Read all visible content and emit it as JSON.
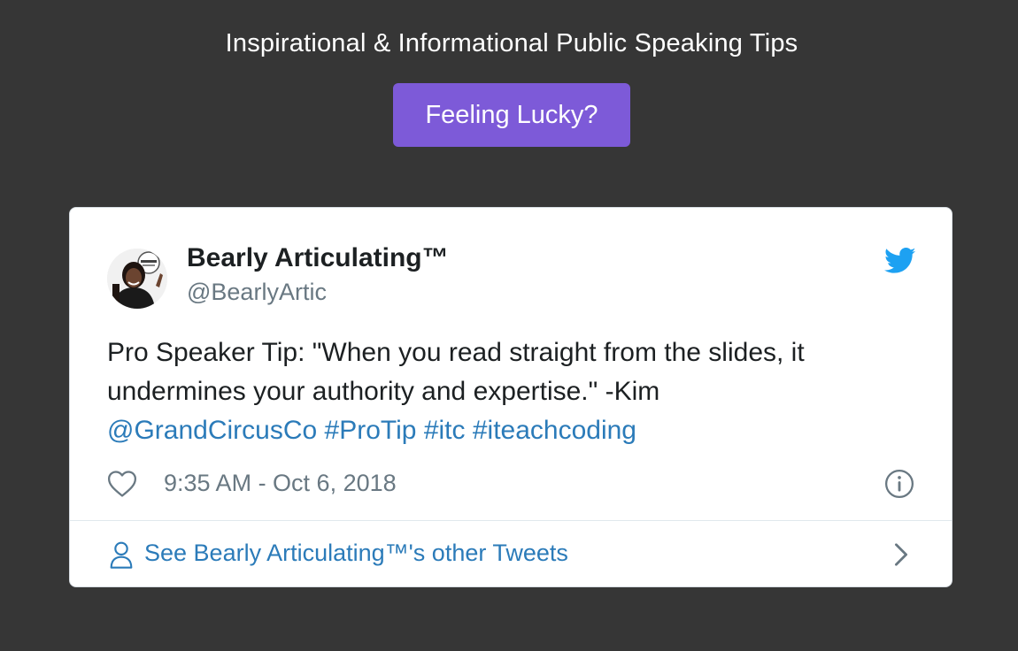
{
  "header": {
    "title": "Inspirational & Informational Public Speaking Tips",
    "button_label": "Feeling Lucky?"
  },
  "tweet": {
    "author_name": "Bearly Articulating™",
    "author_handle": "@BearlyArtic",
    "text_line1": "Pro Speaker Tip: \"When you read straight from the slides, it",
    "text_line2": "undermines your authority and expertise.\" -Kim",
    "mention": "@GrandCircusCo",
    "hashtags": [
      "#ProTip",
      "#itc",
      "#iteachcoding"
    ],
    "timestamp": "9:35 AM - Oct 6, 2018",
    "footer_link": "See Bearly Articulating™'s other Tweets"
  },
  "icons": {
    "brand": "twitter-bird-icon",
    "like": "heart-icon",
    "info": "info-icon",
    "profile": "person-icon",
    "more": "chevron-right-icon"
  },
  "colors": {
    "background": "#363636",
    "button": "#7d5ad8",
    "link": "#2b7bb9",
    "twitter_blue": "#1da1f2",
    "muted": "#697882"
  }
}
